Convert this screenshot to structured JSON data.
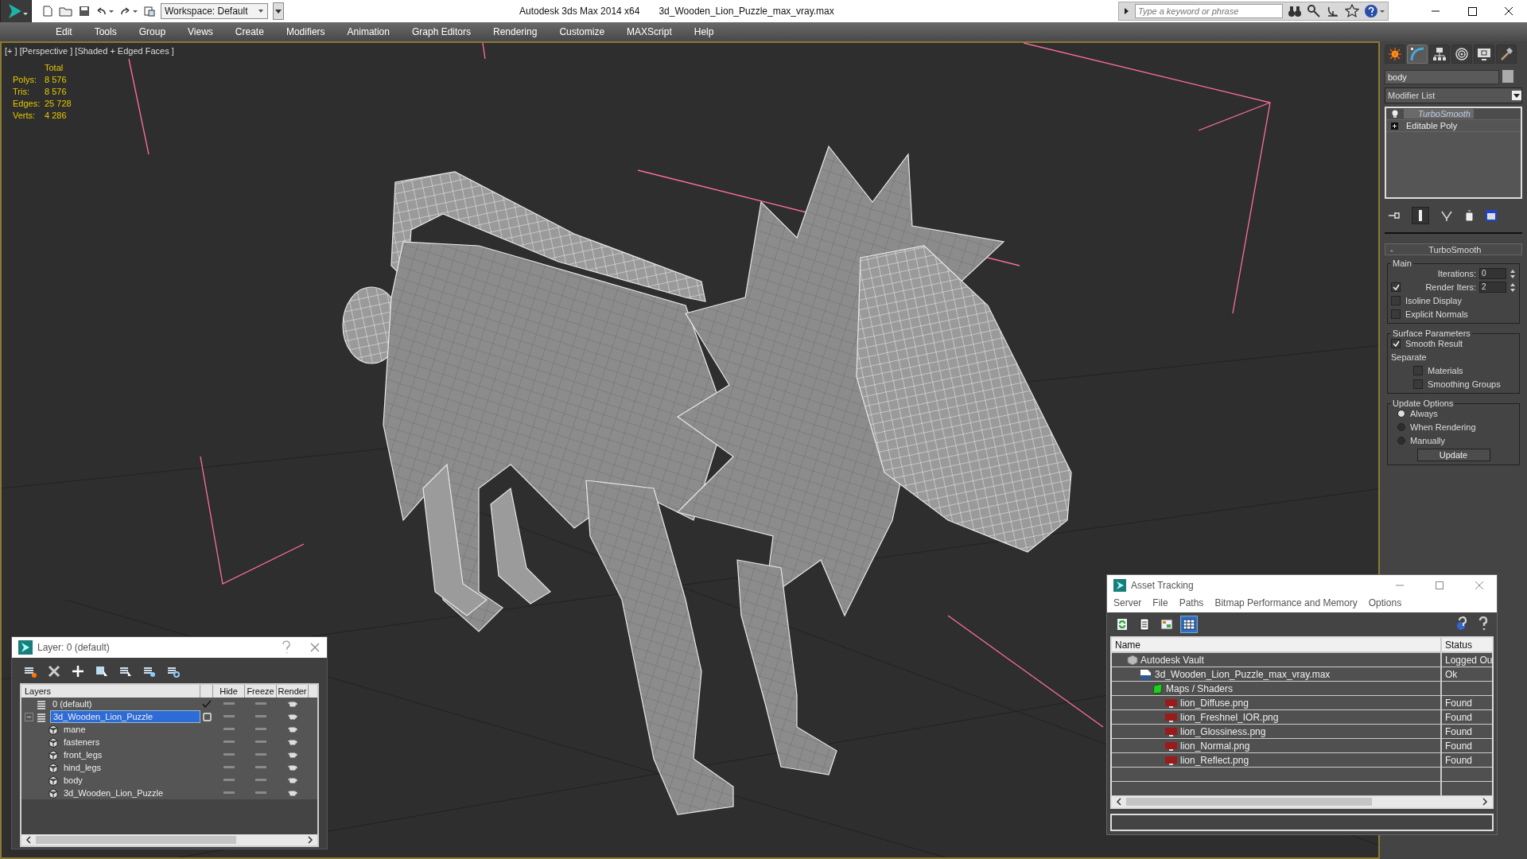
{
  "title_bar": {
    "workspace": "Workspace: Default",
    "app_title": "Autodesk 3ds Max  2014 x64",
    "file_name": "3d_Wooden_Lion_Puzzle_max_vray.max",
    "search": {
      "placeholder": "Type a keyword or phrase"
    }
  },
  "menu": [
    "Edit",
    "Tools",
    "Group",
    "Views",
    "Create",
    "Modifiers",
    "Animation",
    "Graph Editors",
    "Rendering",
    "Customize",
    "MAXScript",
    "Help"
  ],
  "viewport": {
    "label": "[+ ] [Perspective ] [Shaded + Edged Faces ]",
    "stats": {
      "header": "Total",
      "rows": [
        {
          "label": "Polys:",
          "value": "8 576"
        },
        {
          "label": "Tris:",
          "value": "8 576"
        },
        {
          "label": "Edges:",
          "value": "25 728"
        },
        {
          "label": "Verts:",
          "value": "4 286"
        }
      ]
    }
  },
  "command_panel": {
    "tabs": [
      {
        "kind": "create",
        "selected": false
      },
      {
        "kind": "modify",
        "selected": true
      },
      {
        "kind": "hierarchy",
        "selected": false
      },
      {
        "kind": "motion",
        "selected": false
      },
      {
        "kind": "display",
        "selected": false
      },
      {
        "kind": "utilities",
        "selected": false
      }
    ],
    "object_name": "body",
    "modifier_list": "Modifier List",
    "stack": [
      {
        "name": "TurboSmooth",
        "kind": "modifier",
        "selected": true
      },
      {
        "name": "Editable Poly",
        "kind": "base",
        "selected": false
      }
    ],
    "rollout": {
      "collapse": "-",
      "title": "TurboSmooth",
      "groups": [
        {
          "title": "Main",
          "items": [
            {
              "kind": "spinner",
              "label": "Iterations:",
              "value": "0"
            },
            {
              "kind": "check_spinner",
              "label": "Render Iters:",
              "value": "2",
              "checked": true
            },
            {
              "kind": "checkbox",
              "label": "Isoline Display",
              "checked": false
            },
            {
              "kind": "checkbox",
              "label": "Explicit Normals",
              "checked": false
            }
          ]
        },
        {
          "title": "Surface Parameters",
          "items": [
            {
              "kind": "checkbox",
              "label": "Smooth Result",
              "checked": true
            },
            {
              "kind": "label",
              "label": "Separate"
            },
            {
              "kind": "subcheckbox",
              "label": "Materials",
              "checked": false
            },
            {
              "kind": "subcheckbox",
              "label": "Smoothing Groups",
              "checked": false
            }
          ]
        },
        {
          "title": "Update Options",
          "items": [
            {
              "kind": "radio",
              "label": "Always",
              "selected": true
            },
            {
              "kind": "radio",
              "label": "When Rendering",
              "selected": false
            },
            {
              "kind": "radio",
              "label": "Manually",
              "selected": false
            },
            {
              "kind": "button",
              "label": "Update"
            }
          ]
        }
      ]
    }
  },
  "layer_dialog": {
    "title": "Layer: 0 (default)",
    "columns": [
      "Layers",
      "Hide",
      "Freeze",
      "Render"
    ],
    "layers": [
      {
        "name": "0 (default)",
        "kind": "layer",
        "current": true,
        "selected": false
      },
      {
        "name": "3d_Wooden_Lion_Puzzle",
        "kind": "layer",
        "current": false,
        "selected": true,
        "expanded": true,
        "children": [
          {
            "name": "mane",
            "kind": "object",
            "selected": false
          },
          {
            "name": "fasteners",
            "kind": "object",
            "selected": false
          },
          {
            "name": "front_legs",
            "kind": "object",
            "selected": false
          },
          {
            "name": "hind_legs",
            "kind": "object",
            "selected": false
          },
          {
            "name": "body",
            "kind": "object",
            "selected": false
          },
          {
            "name": "3d_Wooden_Lion_Puzzle",
            "kind": "object",
            "selected": false
          }
        ]
      }
    ]
  },
  "asset_tracking": {
    "title": "Asset Tracking",
    "menu": [
      "Server",
      "File",
      "Paths",
      "Bitmap Performance and Memory",
      "Options"
    ],
    "toolbar": [
      {
        "kind": "refresh",
        "selected": false
      },
      {
        "kind": "list",
        "selected": false
      },
      {
        "kind": "thumbnails",
        "selected": false
      },
      {
        "kind": "table",
        "selected": true
      }
    ],
    "columns": [
      "Name",
      "Status"
    ],
    "assets": [
      {
        "name": "Autodesk Vault",
        "kind": "vault",
        "status": "Logged Ou",
        "children": [
          {
            "name": "3d_Wooden_Lion_Puzzle_max_vray.max",
            "kind": "max",
            "status": "Ok",
            "children": [
              {
                "name": "Maps / Shaders",
                "kind": "folder",
                "children": [
                  {
                    "name": "lion_Diffuse.png",
                    "kind": "png",
                    "status": "Found"
                  },
                  {
                    "name": "lion_Freshnel_IOR.png",
                    "kind": "png",
                    "status": "Found"
                  },
                  {
                    "name": "lion_Glossiness.png",
                    "kind": "png",
                    "status": "Found"
                  },
                  {
                    "name": "lion_Normal.png",
                    "kind": "png",
                    "status": "Found"
                  },
                  {
                    "name": "lion_Reflect.png",
                    "kind": "png",
                    "status": "Found"
                  }
                ]
              }
            ]
          }
        ]
      }
    ]
  }
}
